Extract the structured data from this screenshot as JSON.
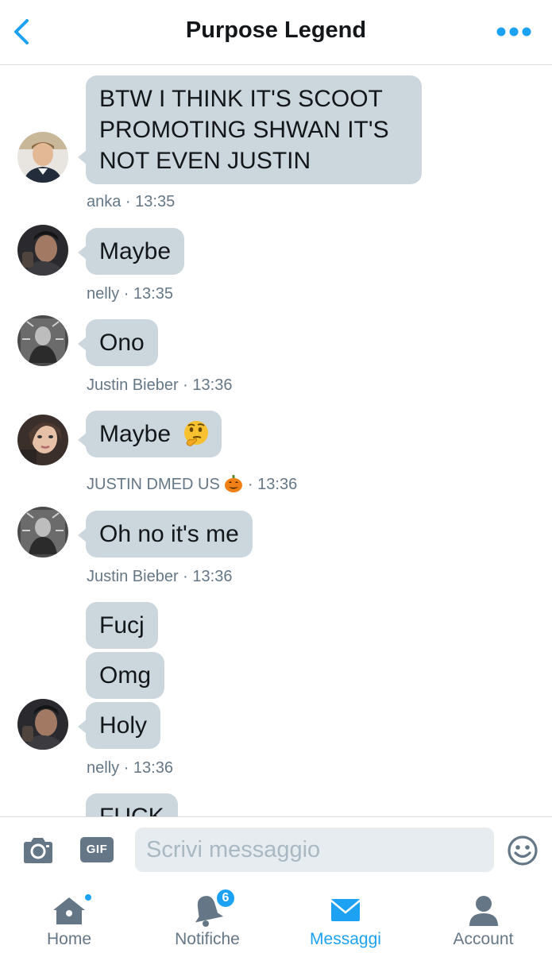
{
  "header": {
    "title": "Purpose Legend",
    "back_icon": "chevron-left-icon",
    "more_icon": "more-dots-icon",
    "accent": "#1da1f2"
  },
  "messages": [
    {
      "text": "BTW I THINK IT'S SCOOT PROMOTING SHWAN IT'S NOT EVEN JUSTIN",
      "lines": [
        "BTW I THINK IT'S SCOOT",
        "PROMOTING SHWAN IT'S",
        "NOT EVEN JUSTIN"
      ],
      "sender": "anka",
      "time": "13:35"
    },
    {
      "text": "Maybe",
      "sender": "nelly",
      "time": "13:35"
    },
    {
      "text": "Ono",
      "sender": "Justin Bieber",
      "time": "13:36"
    },
    {
      "text": "Maybe",
      "emoji": "thinking-face",
      "sender": "JUSTIN DMED US",
      "sender_emoji": "jack-o-lantern",
      "time": "13:36"
    },
    {
      "text": "Oh no it's me",
      "sender": "Justin Bieber",
      "time": "13:36"
    },
    {
      "text": "Fucj"
    },
    {
      "text": "Omg"
    },
    {
      "text": "Holy",
      "sender": "nelly",
      "time": "13:36"
    },
    {
      "text": "FUCK"
    }
  ],
  "meta_separator": " · ",
  "composer": {
    "placeholder": "Scrivi messaggio",
    "gif_label": "GIF",
    "camera_icon": "camera-icon",
    "emoji_icon": "smiley-icon"
  },
  "tabs": [
    {
      "label": "Home",
      "icon": "home-icon",
      "has_dot": true
    },
    {
      "label": "Notifiche",
      "icon": "bell-icon",
      "badge": "6"
    },
    {
      "label": "Messaggi",
      "icon": "envelope-icon",
      "active": true
    },
    {
      "label": "Account",
      "icon": "person-icon"
    }
  ],
  "colors": {
    "bubble": "#ccd6dd",
    "meta_text": "#657786",
    "accent": "#1da1f2"
  }
}
